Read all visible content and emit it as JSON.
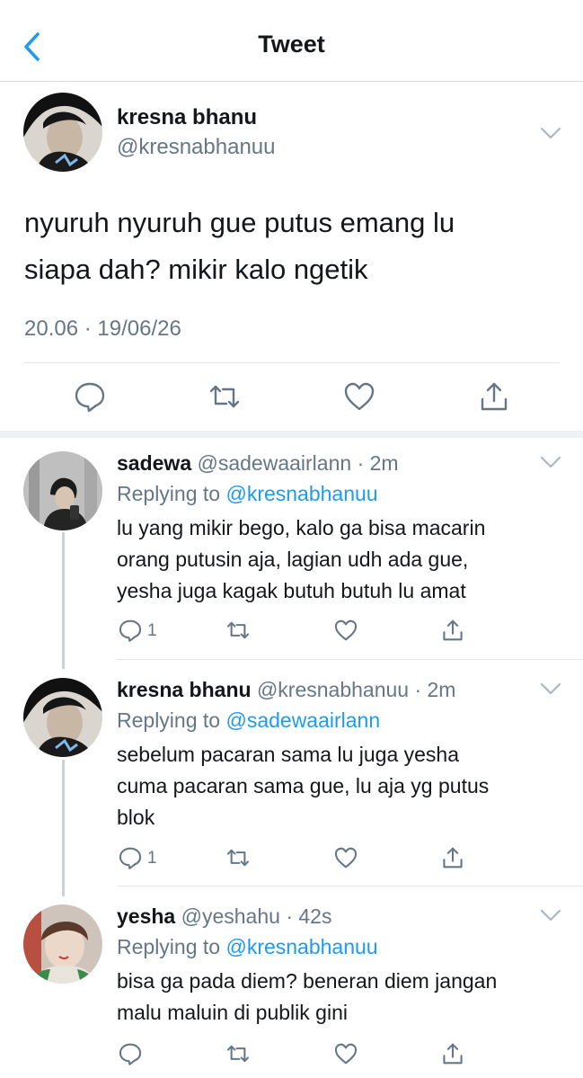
{
  "header": {
    "title": "Tweet"
  },
  "main_tweet": {
    "display_name": "kresna bhanu",
    "handle": "@kresnabhanuu",
    "text_line1": "nyuruh nyuruh gue putus emang lu",
    "text_line2": "siapa dah? mikir kalo ngetik",
    "timestamp": "20.06 · 19/06/26"
  },
  "replies": [
    {
      "display_name": "sadewa",
      "handle": "@sadewaairlann",
      "time": "· 2m",
      "replying_prefix": "Replying to",
      "replying_handle": "@kresnabhanuu",
      "lines": [
        "lu yang mikir bego, kalo ga bisa macarin",
        "orang putusin aja, lagian udh ada gue,",
        "yesha juga kagak butuh butuh lu amat"
      ],
      "reply_count": "1"
    },
    {
      "display_name": "kresna bhanu",
      "handle": "@kresnabhanuu",
      "time": "· 2m",
      "replying_prefix": "Replying to",
      "replying_handle": "@sadewaairlann",
      "lines": [
        "sebelum pacaran sama lu juga yesha",
        "cuma pacaran sama gue, lu aja yg putus",
        "blok"
      ],
      "reply_count": "1"
    },
    {
      "display_name": "yesha",
      "handle": "@yeshahu",
      "time": "· 42s",
      "replying_prefix": "Replying to",
      "replying_handle": "@kresnabhanuu",
      "lines": [
        "bisa ga pada diem? beneran diem jangan",
        "malu maluin di publik gini"
      ],
      "reply_count": ""
    }
  ],
  "icons": {
    "back": "chevron-left-icon",
    "more": "chevron-down-icon",
    "reply": "speech-bubble-icon",
    "retweet": "retweet-icon",
    "like": "heart-icon",
    "share": "share-icon"
  },
  "colors": {
    "accent": "#1d9bf0",
    "muted": "#657786",
    "divider": "#e1e6ea"
  }
}
